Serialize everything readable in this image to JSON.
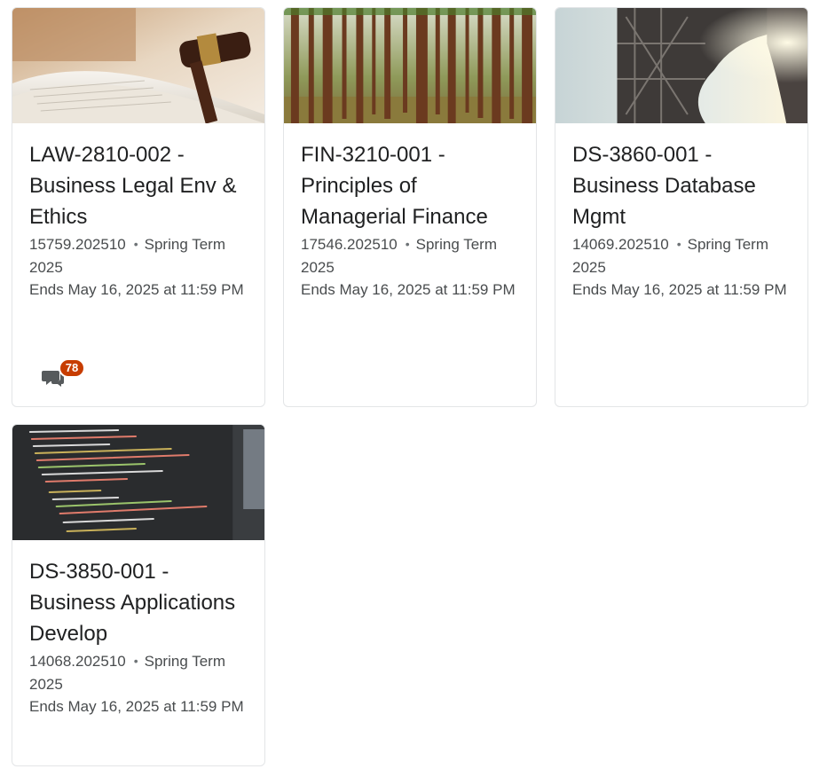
{
  "courses": [
    {
      "title": "LAW-2810-002 - Business Legal Env & Ethics",
      "code": "15759.202510",
      "term": "Spring Term 2025",
      "ends": "Ends May 16, 2025 at 11:59 PM",
      "image": "gavel-and-book-image",
      "notification_count": "78",
      "notification_icon": "chat-bubbles-icon"
    },
    {
      "title": "FIN-3210-001 - Principles of Managerial Finance",
      "code": "17546.202510",
      "term": "Spring Term 2025",
      "ends": "Ends May 16, 2025 at 11:59 PM",
      "image": "forest-image"
    },
    {
      "title": "DS-3860-001 - Business Database Mgmt",
      "code": "14069.202510",
      "term": "Spring Term 2025",
      "ends": "Ends May 16, 2025 at 11:59 PM",
      "image": "bridge-image"
    },
    {
      "title": "DS-3850-001 - Business Applications Develop",
      "code": "14068.202510",
      "term": "Spring Term 2025",
      "ends": "Ends May 16, 2025 at 11:59 PM",
      "image": "code-screen-image"
    }
  ],
  "separator": "•",
  "colors": {
    "badge": "#c73d00",
    "title_text": "#202122",
    "meta_text": "#494c4e",
    "card_border": "#e3e5e7"
  }
}
